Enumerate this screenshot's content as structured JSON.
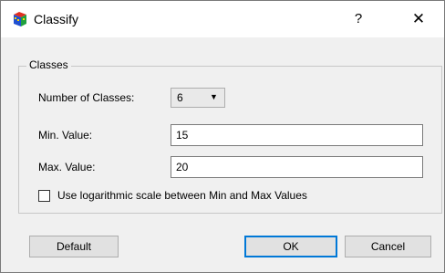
{
  "window": {
    "title": "Classify",
    "help_label": "?",
    "close_label": "✕"
  },
  "group": {
    "title": "Classes",
    "num_classes_label": "Number of Classes:",
    "num_classes_value": "6",
    "min_label": "Min. Value:",
    "min_value": "15",
    "max_label": "Max. Value:",
    "max_value": "20",
    "log_label": "Use logarithmic scale between Min and Max Values",
    "log_checked": false
  },
  "buttons": {
    "default": "Default",
    "ok": "OK",
    "cancel": "Cancel"
  }
}
